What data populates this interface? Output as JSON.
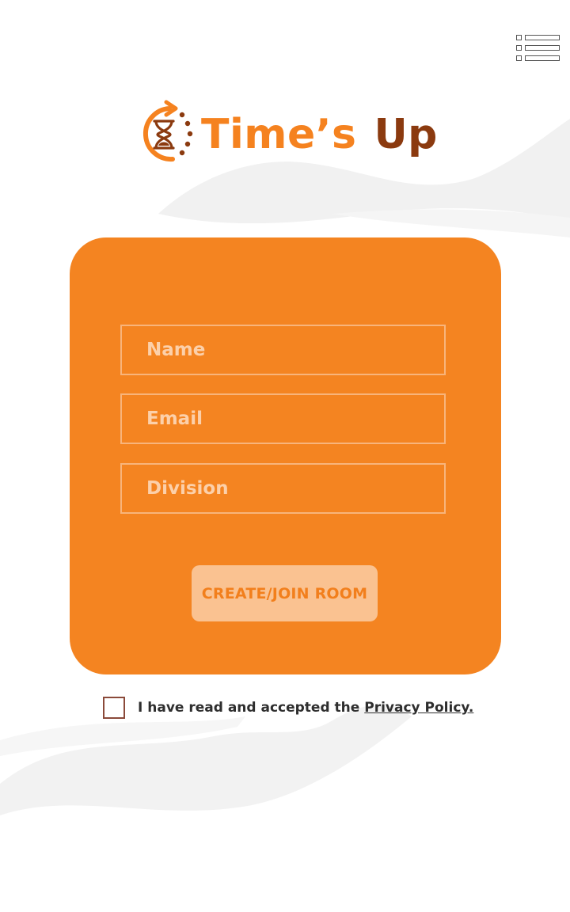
{
  "app": {
    "title_primary": "Time’s",
    "title_secondary": "Up"
  },
  "colors": {
    "brand_orange": "#f48421",
    "brand_brown": "#8b3a0f",
    "field_border": "#f8b47b",
    "button_bg": "#fac291",
    "button_text": "#f27f1c",
    "background": "#ffffff"
  },
  "icons": {
    "menu": "list-menu-icon",
    "logo": "hourglass-clock-icon",
    "checkbox": "checkbox-empty-icon"
  },
  "form": {
    "name_placeholder": "Name",
    "email_placeholder": "Email",
    "division_placeholder": "Division",
    "submit_label": "CREATE/JOIN ROOM"
  },
  "consent": {
    "checked": false,
    "text": "I have read and accepted the ",
    "link_text": "Privacy Policy."
  }
}
